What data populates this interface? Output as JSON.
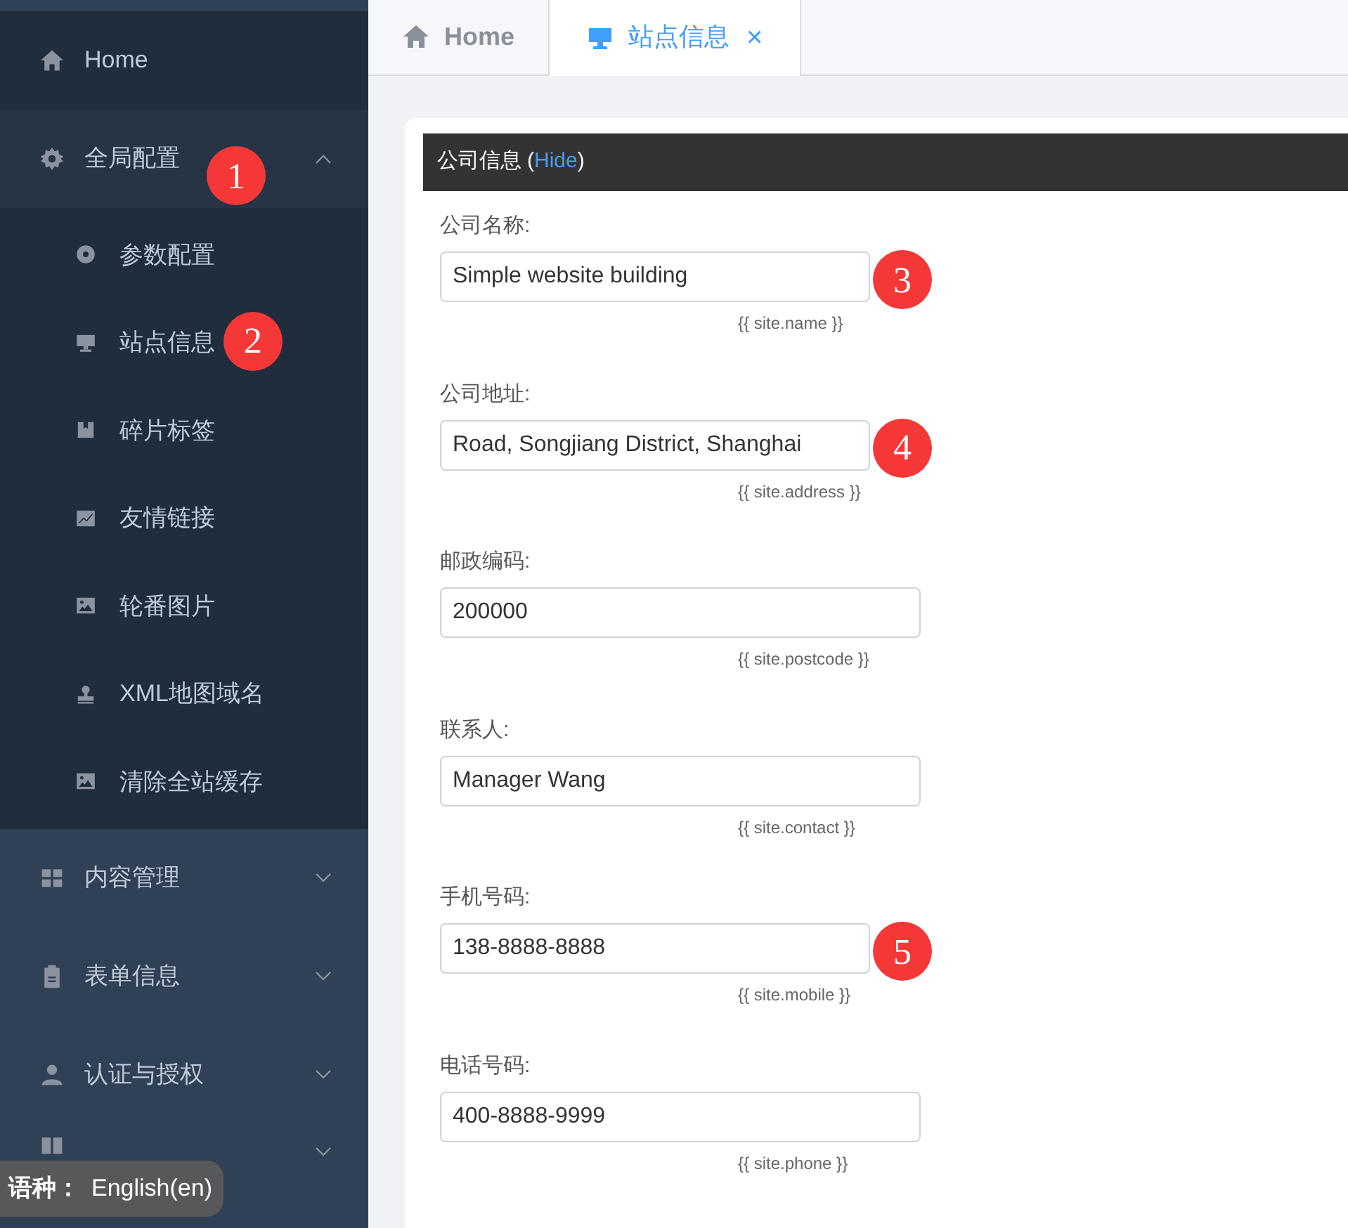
{
  "sidebar": {
    "items": [
      {
        "kind": "link",
        "label": "Home"
      },
      {
        "kind": "group",
        "label": "全局配置",
        "expanded": true,
        "marker": "1",
        "children": [
          {
            "label": "参数配置"
          },
          {
            "label": "站点信息",
            "marker": "2"
          },
          {
            "label": "碎片标签"
          },
          {
            "label": "友情链接"
          },
          {
            "label": "轮番图片"
          },
          {
            "label": "XML地图域名"
          },
          {
            "label": "清除全站缓存"
          }
        ]
      },
      {
        "kind": "group",
        "label": "内容管理",
        "expanded": false
      },
      {
        "kind": "group",
        "label": "表单信息",
        "expanded": false
      },
      {
        "kind": "group",
        "label": "认证与授权",
        "expanded": false
      },
      {
        "kind": "group",
        "expanded": false
      }
    ]
  },
  "language_badge": {
    "label": "语种：",
    "value": "English(en)"
  },
  "tabs": [
    {
      "label": "Home",
      "selected": false,
      "closable": false
    },
    {
      "label": "站点信息",
      "selected": true,
      "closable": true,
      "close": "×"
    }
  ],
  "panel": {
    "title": "公司信息",
    "bracket_open": "(",
    "toggle": "Hide",
    "bracket_close": ")",
    "fields": [
      {
        "label": "公司名称:",
        "value": "Simple website building",
        "hint": "{{ site.name }}",
        "marker": "3"
      },
      {
        "label": "公司地址:",
        "value": "Road, Songjiang District, Shanghai",
        "hint": "{{ site.address }}",
        "marker": "4"
      },
      {
        "label": "邮政编码:",
        "value": "200000",
        "hint": "{{ site.postcode }}"
      },
      {
        "label": "联系人:",
        "value": "Manager Wang",
        "hint": "{{ site.contact }}"
      },
      {
        "label": "手机号码:",
        "value": "138-8888-8888",
        "hint": "{{ site.mobile }}",
        "marker": "5"
      },
      {
        "label": "电话号码:",
        "value": "400-8888-9999",
        "hint": "{{ site.phone }}"
      }
    ]
  }
}
